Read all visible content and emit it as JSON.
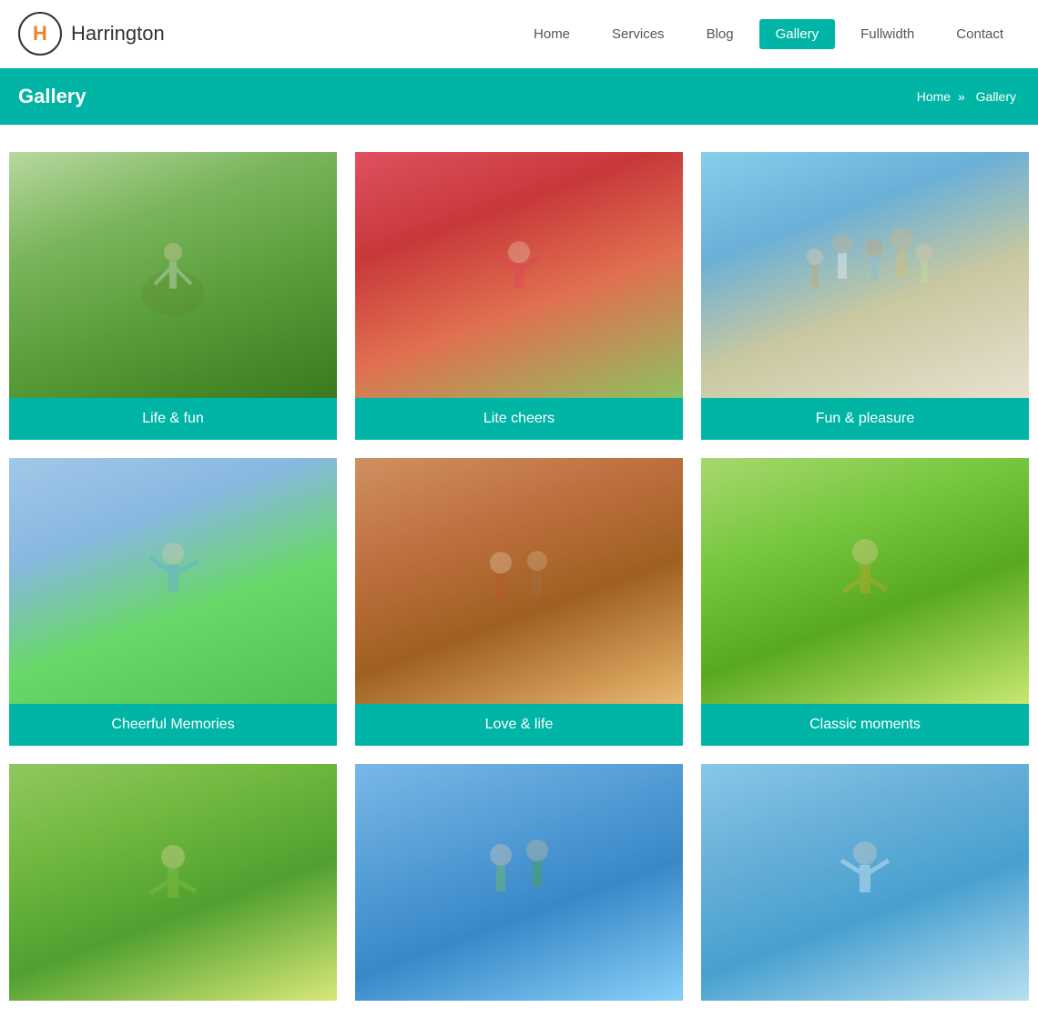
{
  "site": {
    "logo_letter": "H",
    "logo_name": "Harrington"
  },
  "nav": {
    "items": [
      {
        "label": "Home",
        "active": false
      },
      {
        "label": "Services",
        "active": false
      },
      {
        "label": "Blog",
        "active": false
      },
      {
        "label": "Gallery",
        "active": true
      },
      {
        "label": "Fullwidth",
        "active": false
      },
      {
        "label": "Contact",
        "active": false
      }
    ]
  },
  "breadcrumb": {
    "title": "Gallery",
    "home_label": "Home",
    "separator": "»",
    "current": "Gallery"
  },
  "gallery": {
    "items": [
      {
        "id": 1,
        "caption": "Life & fun",
        "img_class": "img-1"
      },
      {
        "id": 2,
        "caption": "Lite cheers",
        "img_class": "img-2"
      },
      {
        "id": 3,
        "caption": "Fun & pleasure",
        "img_class": "img-3"
      },
      {
        "id": 4,
        "caption": "Cheerful Memories",
        "img_class": "img-4"
      },
      {
        "id": 5,
        "caption": "Love & life",
        "img_class": "img-5"
      },
      {
        "id": 6,
        "caption": "Classic moments",
        "img_class": "img-6"
      },
      {
        "id": 7,
        "caption": "",
        "img_class": "img-7"
      },
      {
        "id": 8,
        "caption": "",
        "img_class": "img-8"
      },
      {
        "id": 9,
        "caption": "",
        "img_class": "img-9"
      }
    ]
  },
  "colors": {
    "teal": "#00b5a5",
    "orange": "#e8832a"
  }
}
